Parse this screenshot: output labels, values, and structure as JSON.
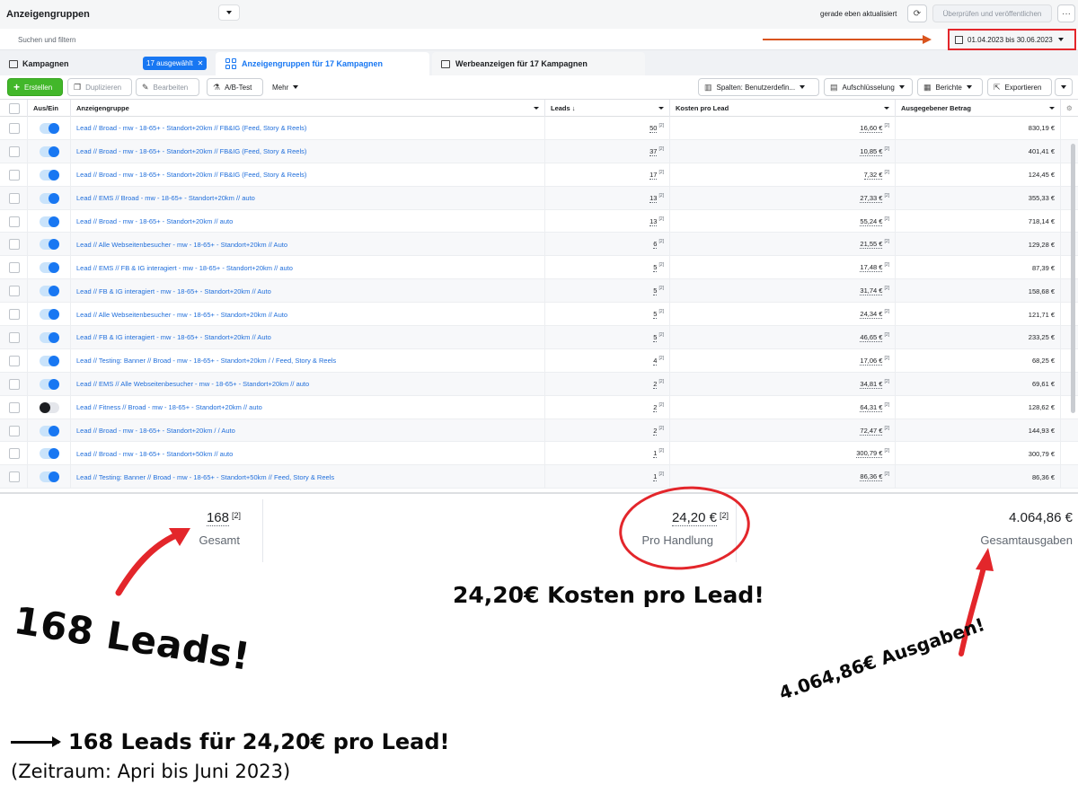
{
  "header": {
    "title": "Anzeigengruppen",
    "updated": "gerade eben aktualisiert",
    "publish_label": "Überprüfen und veröffentlichen",
    "more_label": "···"
  },
  "search": {
    "placeholder": "Suchen und filtern"
  },
  "date_range": {
    "label": "01.04.2023 bis 30.06.2023",
    "highlight_color": "#e3262b",
    "arrow_color": "#d9541e"
  },
  "tabs": {
    "campaigns": "Kampagnen",
    "selected_pill": "17 ausgewählt",
    "adsets": "Anzeigengruppen für 17 Kampagnen",
    "ads": "Werbeanzeigen für 17 Kampagnen"
  },
  "toolbar": {
    "create": "Erstellen",
    "duplicate": "Duplizieren",
    "edit": "Bearbeiten",
    "ab_test": "A/B-Test",
    "more": "Mehr",
    "columns": "Spalten: Benutzerdefin...",
    "breakdown": "Aufschlüsselung",
    "reports": "Berichte",
    "export": "Exportieren"
  },
  "table": {
    "headers": {
      "toggle": "Aus/Ein",
      "name": "Anzeigengruppe",
      "leads": "Leads ↓",
      "cpl": "Kosten pro Lead",
      "spent": "Ausgegebener Betrag"
    },
    "rows": [
      {
        "on": true,
        "name": "Lead // Broad - mw - 18-65+ - Standort+20km // FB&IG (Feed, Story & Reels)",
        "leads": "50",
        "cpl": "16,60 €",
        "spent": "830,19 €"
      },
      {
        "on": true,
        "name": "Lead // Broad - mw - 18-65+ - Standort+20km // FB&IG (Feed, Story & Reels)",
        "leads": "37",
        "cpl": "10,85 €",
        "spent": "401,41 €"
      },
      {
        "on": true,
        "name": "Lead // Broad - mw - 18-65+ - Standort+20km // FB&IG (Feed, Story & Reels)",
        "leads": "17",
        "cpl": "7,32 €",
        "spent": "124,45 €"
      },
      {
        "on": true,
        "name": "Lead // EMS // Broad - mw - 18-65+ - Standort+20km // auto",
        "leads": "13",
        "cpl": "27,33 €",
        "spent": "355,33 €"
      },
      {
        "on": true,
        "name": "Lead // Broad - mw - 18-65+ - Standort+20km // auto",
        "leads": "13",
        "cpl": "55,24 €",
        "spent": "718,14 €"
      },
      {
        "on": true,
        "name": "Lead // Alle Webseitenbesucher - mw - 18-65+ - Standort+20km // Auto",
        "leads": "6",
        "cpl": "21,55 €",
        "spent": "129,28 €"
      },
      {
        "on": true,
        "name": "Lead // EMS // FB & IG interagiert - mw - 18-65+ - Standort+20km // auto",
        "leads": "5",
        "cpl": "17,48 €",
        "spent": "87,39 €"
      },
      {
        "on": true,
        "name": "Lead // FB & IG interagiert - mw - 18-65+ - Standort+20km // Auto",
        "leads": "5",
        "cpl": "31,74 €",
        "spent": "158,68 €"
      },
      {
        "on": true,
        "name": "Lead // Alle Webseitenbesucher - mw - 18-65+ - Standort+20km // Auto",
        "leads": "5",
        "cpl": "24,34 €",
        "spent": "121,71 €"
      },
      {
        "on": true,
        "name": "Lead // FB & IG interagiert - mw - 18-65+ - Standort+20km // Auto",
        "leads": "5",
        "cpl": "46,65 €",
        "spent": "233,25 €"
      },
      {
        "on": true,
        "name": "Lead // Testing: Banner // Broad - mw - 18-65+ - Standort+20km / / Feed, Story & Reels",
        "leads": "4",
        "cpl": "17,06 €",
        "spent": "68,25 €"
      },
      {
        "on": true,
        "name": "Lead // EMS // Alle Webseitenbesucher - mw - 18-65+ - Standort+20km // auto",
        "leads": "2",
        "cpl": "34,81 €",
        "spent": "69,61 €"
      },
      {
        "on": false,
        "name": "Lead // Fitness // Broad - mw - 18-65+ - Standort+20km // auto",
        "leads": "2",
        "cpl": "64,31 €",
        "spent": "128,62 €"
      },
      {
        "on": true,
        "name": "Lead // Broad - mw - 18-65+ - Standort+20km / / Auto",
        "leads": "2",
        "cpl": "72,47 €",
        "spent": "144,93 €"
      },
      {
        "on": true,
        "name": "Lead // Broad - mw - 18-65+ - Standort+50km // auto",
        "leads": "1",
        "cpl": "300,79 €",
        "spent": "300,79 €"
      },
      {
        "on": true,
        "name": "Lead // Testing: Banner // Broad - mw - 18-65+ - Standort+50km // Feed, Story & Reels",
        "leads": "1",
        "cpl": "86,36 €",
        "spent": "86,36 €"
      }
    ],
    "footnote_mark": "[2]"
  },
  "totals": {
    "leads": "168",
    "leads_label": "Gesamt",
    "cpl": "24,20 €",
    "cpl_label": "Pro Handlung",
    "spent": "4.064,86 €",
    "spent_label": "Gesamtausgaben",
    "footnote_mark": "[2]"
  },
  "annotations": {
    "leads": "168 Leads!",
    "cpl": "24,20€ Kosten pro Lead!",
    "spent": "4.064,86€ Ausgaben!",
    "summary": "168 Leads für 24,20€ pro Lead!",
    "period": "(Zeitraum: Apri bis Juni 2023)",
    "color": "#e3262b"
  }
}
